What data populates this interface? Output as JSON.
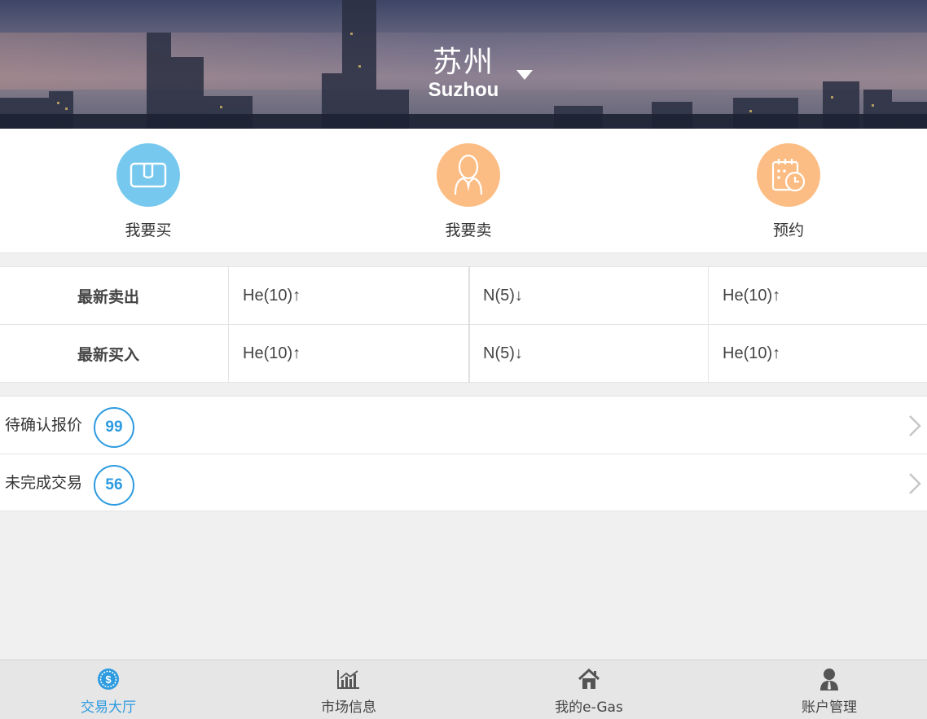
{
  "header": {
    "city_cn": "苏州",
    "city_en": "Suzhou"
  },
  "actions": [
    {
      "label": "我要买",
      "icon": "wallet-icon",
      "color": "#76c8ee"
    },
    {
      "label": "我要卖",
      "icon": "person-tie-icon",
      "color": "#fcbd84"
    },
    {
      "label": "预约",
      "icon": "calendar-clock-icon",
      "color": "#fcbd84"
    }
  ],
  "trades": {
    "rows": [
      {
        "label": "最新卖出",
        "cells": [
          "He(10)↑",
          "N(5)↓",
          "He(10)↑"
        ]
      },
      {
        "label": "最新买入",
        "cells": [
          "He(10)↑",
          "N(5)↓",
          "He(10)↑"
        ]
      }
    ]
  },
  "status_list": [
    {
      "label": "待确认报价",
      "count": "99"
    },
    {
      "label": "未完成交易",
      "count": "56"
    }
  ],
  "tabbar": {
    "active_color": "#2d9be0",
    "tabs": [
      {
        "label": "交易大厅",
        "icon": "dollar-coin-icon",
        "active": true
      },
      {
        "label": "市场信息",
        "icon": "bar-chart-icon",
        "active": false
      },
      {
        "label": "我的e-Gas",
        "icon": "home-icon",
        "active": false
      },
      {
        "label": "账户管理",
        "icon": "user-icon",
        "active": false
      }
    ]
  }
}
